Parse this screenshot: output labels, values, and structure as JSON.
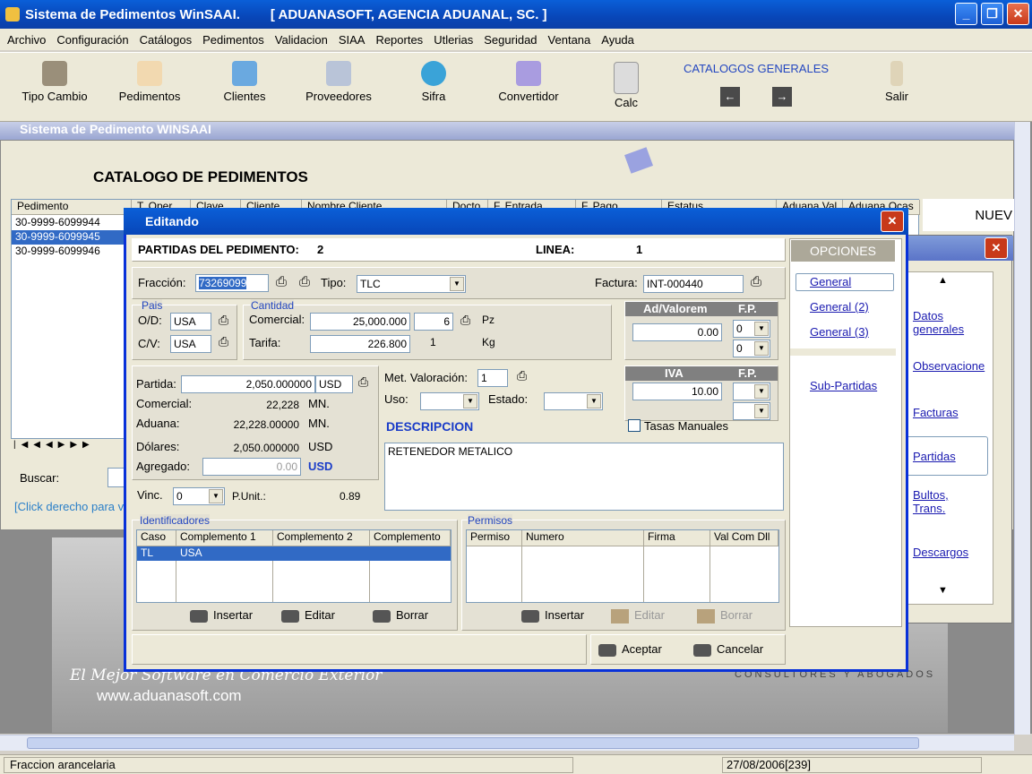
{
  "app": {
    "title": "Sistema de Pedimentos WinSAAI.",
    "company": "[ ADUANASOFT, AGENCIA ADUANAL, SC. ]"
  },
  "menu": [
    "Archivo",
    "Configuración",
    "Catálogos",
    "Pedimentos",
    "Validacion",
    "SIAA",
    "Reportes",
    "Utlerias",
    "Seguridad",
    "Ventana",
    "Ayuda"
  ],
  "toolbar": {
    "tipo_cambio": "Tipo Cambio",
    "pedimentos": "Pedimentos",
    "clientes": "Clientes",
    "proveedores": "Proveedores",
    "sifra": "Sifra",
    "convertidor": "Convertidor",
    "calc": "Calc",
    "catalogos": "CATALOGOS GENERALES",
    "salir": "Salir"
  },
  "inner": {
    "title": "Sistema de Pedimento WINSAAI",
    "catalog_title": "CATALOGO DE PEDIMENTOS",
    "nuev": "NUEV",
    "buscar": "Buscar:",
    "hint": "[Click derecho para v",
    "cols": [
      "Pedimento",
      "T. Oper",
      "Clave",
      "Cliente",
      "Nombre Cliente",
      "Docto",
      "F. Entrada",
      "F. Pago",
      "Estatus",
      "Aduana Val",
      "Aduana Ocas"
    ],
    "rows": [
      "30-9999-6099944",
      "30-9999-6099945",
      "30-9999-6099946"
    ]
  },
  "bg": {
    "slogan": "El Mejor Software en Comercio Exterior",
    "url": "www.aduanasoft.com",
    "consultores": "CONSULTORES Y ABOGADOS"
  },
  "dialog": {
    "title": "Editando",
    "partidas_label": "PARTIDAS DEL PEDIMENTO:",
    "partidas_val": "2",
    "linea_label": "LINEA:",
    "linea_val": "1",
    "fraccion_label": "Fracción:",
    "fraccion": "73269099",
    "tipo_label": "Tipo:",
    "tipo": "TLC",
    "factura_label": "Factura:",
    "factura": "INT-000440",
    "pais_label": "Pais",
    "od_label": "O/D:",
    "od": "USA",
    "cv_label": "C/V:",
    "cv": "USA",
    "cantidad_label": "Cantidad",
    "comercial_label": "Comercial:",
    "comercial": "25,000.000",
    "comercial_n": "6",
    "pz": "Pz",
    "tarifa_label": "Tarifa:",
    "tarifa": "226.800",
    "tarifa_n": "1",
    "kg": "Kg",
    "advalorem_label": "Ad/Valorem",
    "fp_label": "F.P.",
    "advalorem": "0.00",
    "fp1": "0",
    "fp2": "0",
    "iva_label": "IVA",
    "iva": "10.00",
    "tasas": "Tasas Manuales",
    "partida_label": "Partida:",
    "partida": "2,050.000000",
    "moneda": "USD",
    "comercial2_label": "Comercial:",
    "comercial2": "22,228",
    "mn1": "MN.",
    "aduana_label": "Aduana:",
    "aduana": "22,228.00000",
    "mn2": "MN.",
    "dolares_label": "Dólares:",
    "dolares": "2,050.000000",
    "usd1": "USD",
    "agregado_label": "Agregado:",
    "agregado": "0.00",
    "usd2": "USD",
    "metval_label": "Met. Valoración:",
    "metval": "1",
    "uso_label": "Uso:",
    "estado_label": "Estado:",
    "descripcion_label": "DESCRIPCION",
    "descripcion": "RETENEDOR METALICO",
    "vinc_label": "Vinc.",
    "vinc": "0",
    "punit_label": "P.Unit.:",
    "punit": "0.89",
    "ident_label": "Identificadores",
    "ident_cols": [
      "Caso",
      "Complemento 1",
      "Complemento 2",
      "Complemento"
    ],
    "ident_row": [
      "TL",
      "USA",
      "",
      ""
    ],
    "perm_label": "Permisos",
    "perm_cols": [
      "Permiso",
      "Numero",
      "Firma",
      "Val Com Dll"
    ],
    "insertar": "Insertar",
    "editar": "Editar",
    "borrar": "Borrar",
    "insertar2": "Insertar",
    "editar2": "Editar",
    "borrar2": "Borrar",
    "aceptar": "Aceptar",
    "cancelar": "Cancelar"
  },
  "opciones": {
    "title": "OPCIONES",
    "general": "General",
    "general2": "General (2)",
    "general3": "General (3)",
    "subpartidas": "Sub-Partidas"
  },
  "side": {
    "datos": "Datos generales",
    "obs": "Observacione",
    "facturas": "Facturas",
    "partidas": "Partidas",
    "bultos": "Bultos, Trans.",
    "descargos": "Descargos"
  },
  "status": {
    "text": "Fraccion arancelaria",
    "date": "27/08/2006[239]"
  }
}
